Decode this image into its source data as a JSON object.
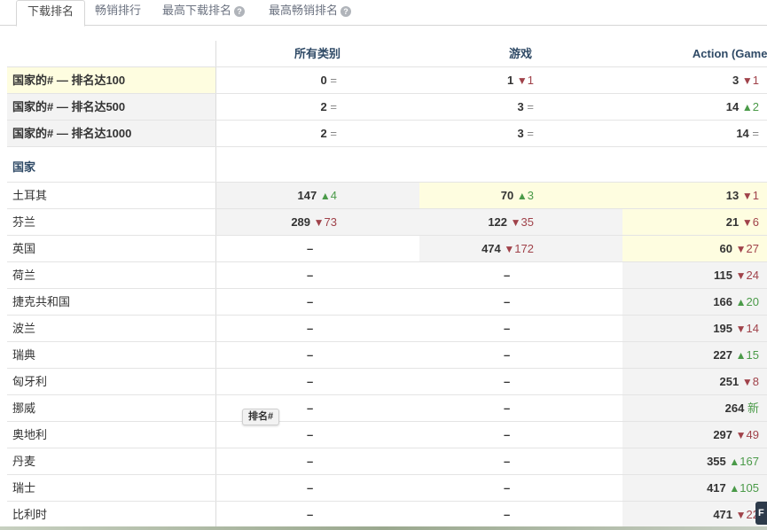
{
  "tabs": [
    {
      "label": "下载排名",
      "active": true,
      "help": false
    },
    {
      "label": "畅销排行",
      "active": false,
      "help": false
    },
    {
      "label": "最高下载排名",
      "active": false,
      "help": true
    },
    {
      "label": "最高畅销排名",
      "active": false,
      "help": true
    }
  ],
  "help_glyph": "?",
  "columns": [
    "所有类别",
    "游戏",
    "Action (Games)"
  ],
  "summary_rows": [
    {
      "label": "国家的# — 排名达100",
      "cells": [
        {
          "rank": "0",
          "dir": "eq",
          "change": "="
        },
        {
          "rank": "1",
          "dir": "dn",
          "change": "1"
        },
        {
          "rank": "3",
          "dir": "dn",
          "change": "1"
        }
      ]
    },
    {
      "label": "国家的# — 排名达500",
      "cells": [
        {
          "rank": "2",
          "dir": "eq",
          "change": "="
        },
        {
          "rank": "3",
          "dir": "eq",
          "change": "="
        },
        {
          "rank": "14",
          "dir": "up",
          "change": "2"
        }
      ]
    },
    {
      "label": "国家的# — 排名达1000",
      "cells": [
        {
          "rank": "2",
          "dir": "eq",
          "change": "="
        },
        {
          "rank": "3",
          "dir": "eq",
          "change": "="
        },
        {
          "rank": "14",
          "dir": "eq",
          "change": "="
        }
      ]
    }
  ],
  "section_label": "国家",
  "country_rows": [
    {
      "label": "土耳其",
      "cells": [
        {
          "rank": "147",
          "dir": "up",
          "change": "4"
        },
        {
          "rank": "70",
          "dir": "up",
          "change": "3"
        },
        {
          "rank": "13",
          "dir": "dn",
          "change": "1"
        }
      ]
    },
    {
      "label": "芬兰",
      "cells": [
        {
          "rank": "289",
          "dir": "dn",
          "change": "73"
        },
        {
          "rank": "122",
          "dir": "dn",
          "change": "35"
        },
        {
          "rank": "21",
          "dir": "dn",
          "change": "6"
        }
      ]
    },
    {
      "label": "英国",
      "cells": [
        {
          "rank": "–",
          "dir": "none",
          "change": ""
        },
        {
          "rank": "474",
          "dir": "dn",
          "change": "172"
        },
        {
          "rank": "60",
          "dir": "dn",
          "change": "27"
        }
      ]
    },
    {
      "label": "荷兰",
      "cells": [
        {
          "rank": "–",
          "dir": "none",
          "change": ""
        },
        {
          "rank": "–",
          "dir": "none",
          "change": ""
        },
        {
          "rank": "115",
          "dir": "dn",
          "change": "24"
        }
      ]
    },
    {
      "label": "捷克共和国",
      "cells": [
        {
          "rank": "–",
          "dir": "none",
          "change": ""
        },
        {
          "rank": "–",
          "dir": "none",
          "change": ""
        },
        {
          "rank": "166",
          "dir": "up",
          "change": "20"
        }
      ]
    },
    {
      "label": "波兰",
      "cells": [
        {
          "rank": "–",
          "dir": "none",
          "change": ""
        },
        {
          "rank": "–",
          "dir": "none",
          "change": ""
        },
        {
          "rank": "195",
          "dir": "dn",
          "change": "14"
        }
      ]
    },
    {
      "label": "瑞典",
      "cells": [
        {
          "rank": "–",
          "dir": "none",
          "change": ""
        },
        {
          "rank": "–",
          "dir": "none",
          "change": ""
        },
        {
          "rank": "227",
          "dir": "up",
          "change": "15"
        }
      ]
    },
    {
      "label": "匈牙利",
      "cells": [
        {
          "rank": "–",
          "dir": "none",
          "change": ""
        },
        {
          "rank": "–",
          "dir": "none",
          "change": ""
        },
        {
          "rank": "251",
          "dir": "dn",
          "change": "8"
        }
      ]
    },
    {
      "label": "挪威",
      "cells": [
        {
          "rank": "–",
          "dir": "none",
          "change": ""
        },
        {
          "rank": "–",
          "dir": "none",
          "change": ""
        },
        {
          "rank": "264",
          "dir": "new",
          "change": "新"
        }
      ]
    },
    {
      "label": "奥地利",
      "cells": [
        {
          "rank": "–",
          "dir": "none",
          "change": ""
        },
        {
          "rank": "–",
          "dir": "none",
          "change": ""
        },
        {
          "rank": "297",
          "dir": "dn",
          "change": "49"
        }
      ]
    },
    {
      "label": "丹麦",
      "cells": [
        {
          "rank": "–",
          "dir": "none",
          "change": ""
        },
        {
          "rank": "–",
          "dir": "none",
          "change": ""
        },
        {
          "rank": "355",
          "dir": "up",
          "change": "167"
        }
      ]
    },
    {
      "label": "瑞士",
      "cells": [
        {
          "rank": "–",
          "dir": "none",
          "change": ""
        },
        {
          "rank": "–",
          "dir": "none",
          "change": ""
        },
        {
          "rank": "417",
          "dir": "up",
          "change": "105"
        }
      ]
    },
    {
      "label": "比利时",
      "cells": [
        {
          "rank": "–",
          "dir": "none",
          "change": ""
        },
        {
          "rank": "–",
          "dir": "none",
          "change": ""
        },
        {
          "rank": "471",
          "dir": "dn",
          "change": "22"
        }
      ]
    }
  ],
  "tooltip": "排名#",
  "corner_button": "F",
  "colors": {
    "up": "#4a9a48",
    "down": "#a0424a",
    "highlight": "#fefde0",
    "header": "#2f4a66"
  }
}
